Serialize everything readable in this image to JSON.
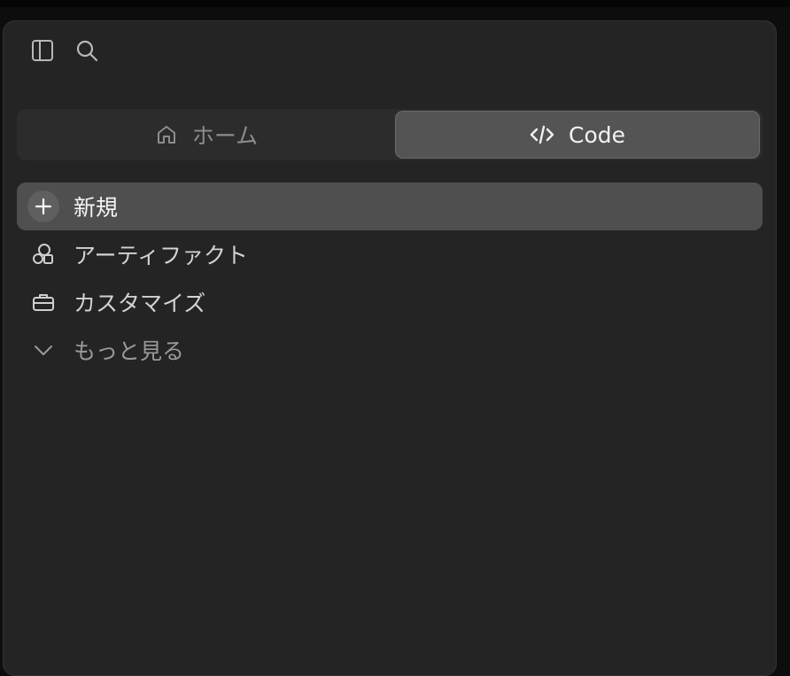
{
  "toolbar": {
    "sidebar_icon": "sidebar-toggle-icon",
    "search_icon": "search-icon"
  },
  "tabs": [
    {
      "label": "ホーム",
      "icon": "home-icon",
      "selected": false
    },
    {
      "label": "Code",
      "icon": "code-icon",
      "selected": true
    }
  ],
  "nav": {
    "items": [
      {
        "label": "新規",
        "icon": "plus-icon",
        "active": true
      },
      {
        "label": "アーティファクト",
        "icon": "shapes-icon",
        "active": false
      },
      {
        "label": "カスタマイズ",
        "icon": "briefcase-icon",
        "active": false
      },
      {
        "label": "もっと見る",
        "icon": "chevron-down-icon",
        "active": false
      }
    ]
  },
  "colors": {
    "panel_bg": "#242424",
    "active_bg": "#4f4f4f",
    "selected_tab_bg": "#545454"
  }
}
